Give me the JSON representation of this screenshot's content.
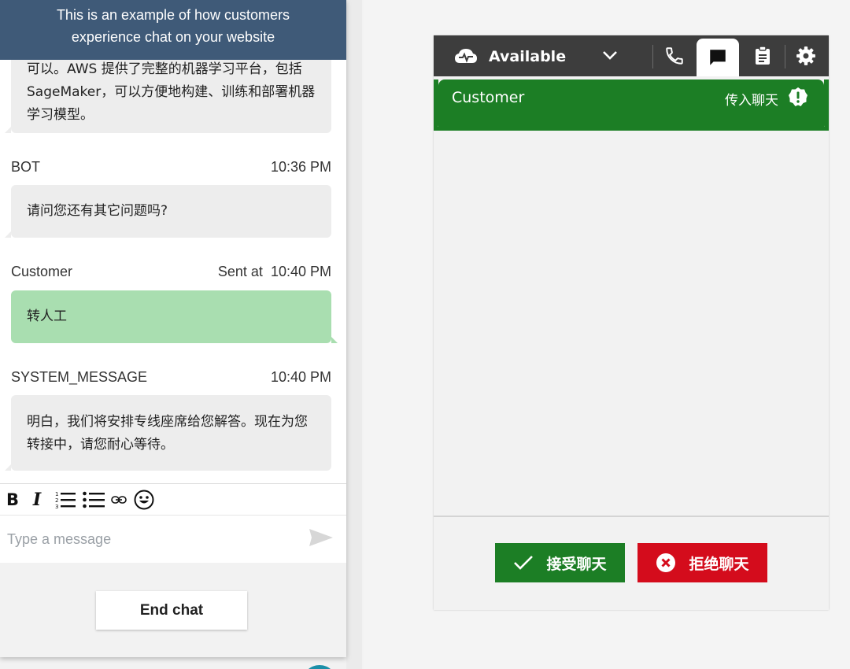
{
  "chat_widget": {
    "banner_text": "This is an example of how customers experience chat on your website",
    "messages": [
      {
        "sender": "",
        "time": "",
        "text": "可以。AWS 提供了完整的机器学习平台，包括 SageMaker，可以方便地构建、训练和部署机器学习模型。"
      },
      {
        "sender": "BOT",
        "time": "10:36 PM",
        "text": "请问您还有其它问题吗?"
      },
      {
        "sender": "Customer",
        "time_prefix": "Sent at",
        "time": "10:40 PM",
        "text": "转人工"
      },
      {
        "sender": "SYSTEM_MESSAGE",
        "time": "10:40 PM",
        "text": "明白，我们将安排专线座席给您解答。现在为您转接中，请您耐心等待。"
      }
    ],
    "toolbar": {
      "bold_label": "B",
      "italic_label": "I",
      "icons": [
        "bold-icon",
        "italic-icon",
        "numbered-list-icon",
        "bulleted-list-icon",
        "link-icon",
        "emoji-icon"
      ]
    },
    "composer": {
      "placeholder": "Type a message",
      "send_icon": "send-icon"
    },
    "end_chat_label": "End chat"
  },
  "ccp": {
    "status": {
      "label": "Available",
      "icon": "cloud-status-icon",
      "chevron_icon": "chevron-down-icon"
    },
    "tabs": [
      {
        "name": "phone",
        "icon": "phone-icon"
      },
      {
        "name": "chat",
        "icon": "chat-icon",
        "active": true
      },
      {
        "name": "tasks",
        "icon": "clipboard-icon"
      },
      {
        "name": "settings",
        "icon": "gear-icon"
      }
    ],
    "contact": {
      "name": "Customer",
      "status": "传入聊天",
      "alert_icon": "alert-icon"
    },
    "actions": {
      "accept_label": "接受聊天",
      "reject_label": "拒绝聊天"
    },
    "colors": {
      "top_bar": "#3d3d3d",
      "contact_green": "#1c7e25",
      "reject_red": "#d40c1c",
      "banner_blue": "#3f5a78",
      "customer_bubble": "#a9deb0",
      "bot_bubble": "#ededed"
    }
  }
}
